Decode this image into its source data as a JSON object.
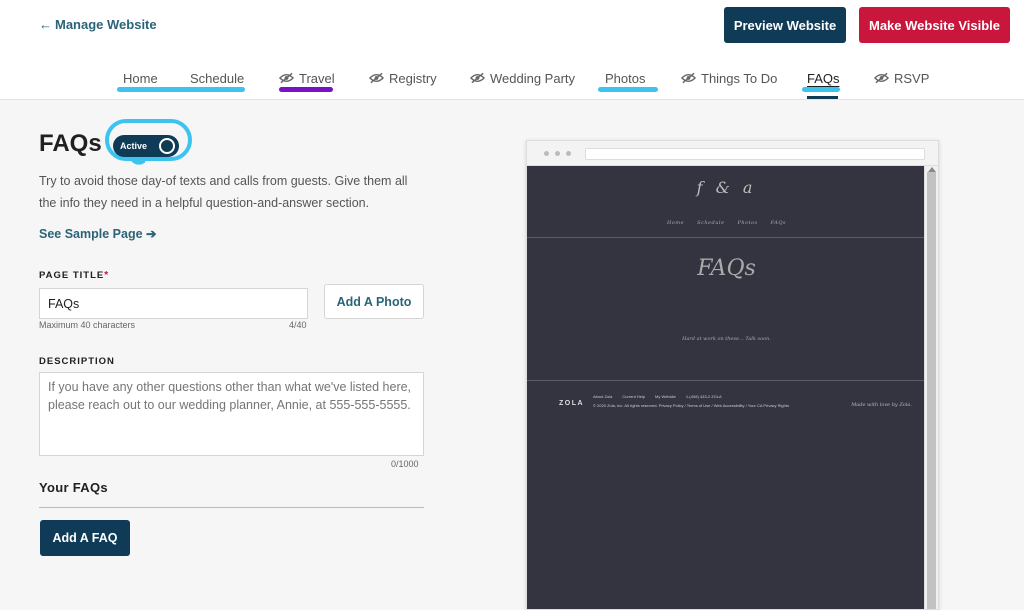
{
  "header": {
    "back_label": "Manage Website",
    "preview_label": "Preview Website",
    "visible_label": "Make Website Visible",
    "colors": {
      "primary": "#0f3b57",
      "danger": "#c8163d",
      "link": "#2a6478"
    }
  },
  "tabs": [
    {
      "label": "Home",
      "hidden": false
    },
    {
      "label": "Schedule",
      "hidden": false
    },
    {
      "label": "Travel",
      "hidden": true
    },
    {
      "label": "Registry",
      "hidden": true
    },
    {
      "label": "Wedding Party",
      "hidden": true
    },
    {
      "label": "Photos",
      "hidden": false
    },
    {
      "label": "Things To Do",
      "hidden": true
    },
    {
      "label": "FAQs",
      "hidden": false,
      "active": true
    },
    {
      "label": "RSVP",
      "hidden": true
    }
  ],
  "page": {
    "title": "FAQs",
    "toggle_label": "Active",
    "description": "Try to avoid those day-of texts and calls from guests. Give them all the info they need in a helpful question-and-answer section.",
    "sample_link": "See Sample Page",
    "page_title_label": "PAGE TITLE",
    "required_mark": "*",
    "page_title_value": "FAQs",
    "page_title_hint": "Maximum 40 characters",
    "page_title_count": "4/40",
    "add_photo_label": "Add A Photo",
    "description_label": "DESCRIPTION",
    "description_placeholder": "If you have any other questions other than what we've listed here, please reach out to our wedding planner, Annie, at 555-555-5555.",
    "description_count": "0/1000",
    "your_faqs_label": "Your FAQs",
    "add_faq_label": "Add A FAQ"
  },
  "preview": {
    "monogram": "f & a",
    "nav": [
      "Home",
      "Schedule",
      "Photos",
      "FAQs"
    ],
    "title": "FAQs",
    "tagline": "Hard at work on these... Talk soon.",
    "footer_brand": "ZOLA",
    "footer_links": [
      "About Zola",
      "Current Help",
      "My Website",
      "1-(408) 433-2 ZOLA"
    ],
    "copyright": "© 2020 Zola, Inc. All rights reserved. Privacy Policy / Terms of Use / Web Accessibility / Your CA Privacy Rights",
    "made_by": "Made with love by Zola."
  }
}
